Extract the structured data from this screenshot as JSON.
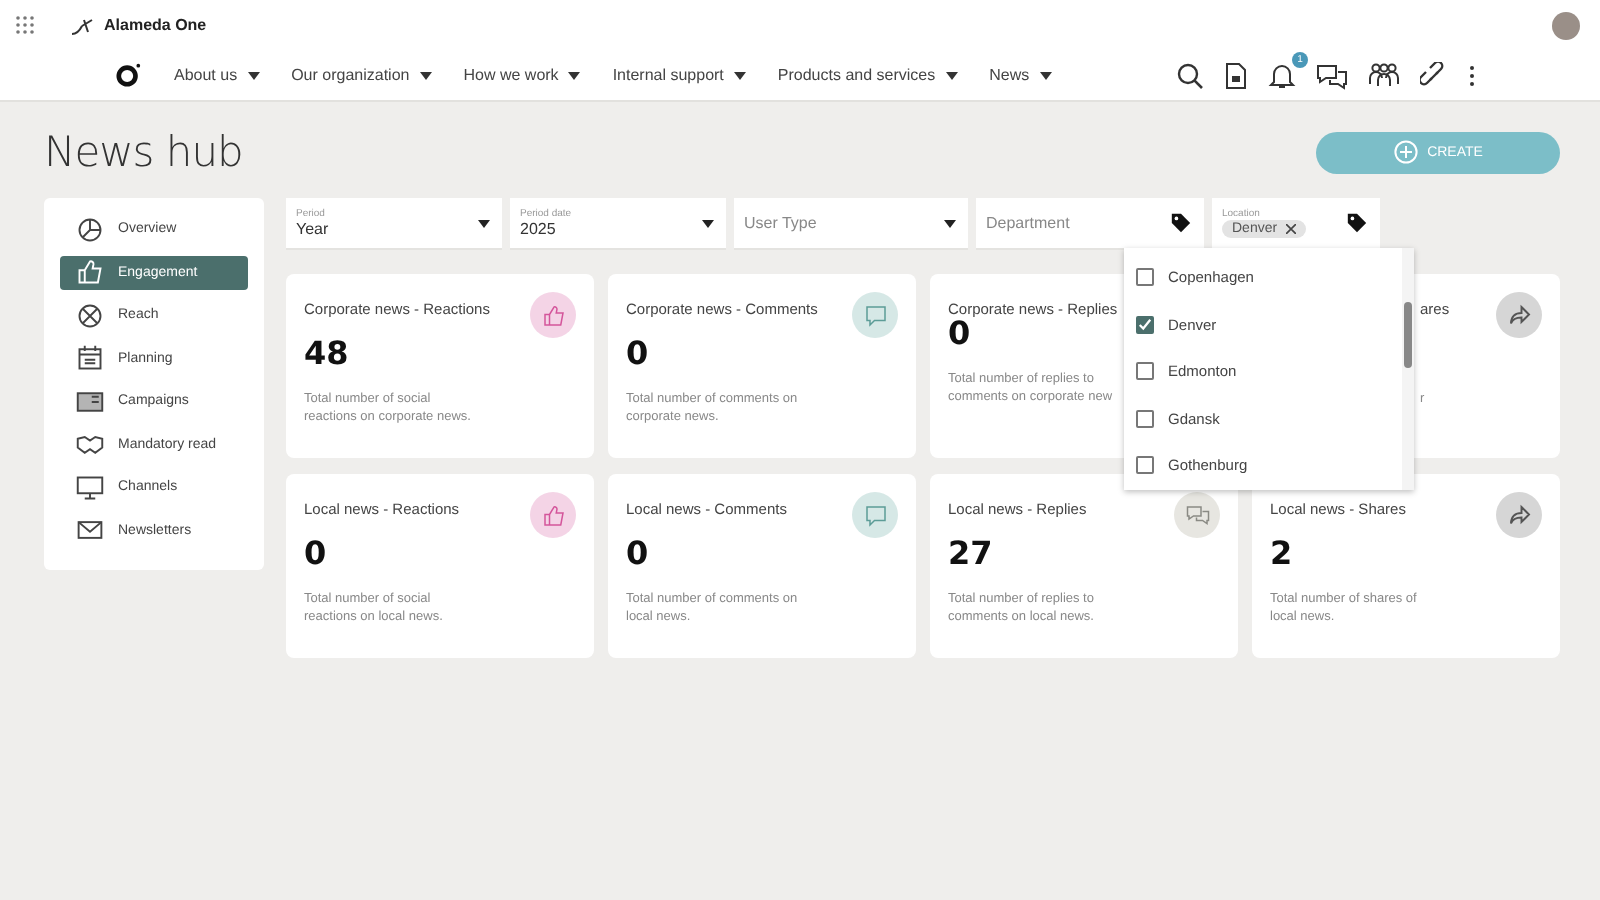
{
  "topbar": {
    "brand": "Alameda One"
  },
  "nav": {
    "items": [
      {
        "label": "About us"
      },
      {
        "label": "Our organization"
      },
      {
        "label": "How we work"
      },
      {
        "label": "Internal support"
      },
      {
        "label": "Products and services"
      },
      {
        "label": "News"
      }
    ],
    "notification_badge": "1"
  },
  "page": {
    "title": "News hub",
    "create_button": "CREATE"
  },
  "sidebar": {
    "items": [
      {
        "label": "Overview",
        "selected": false
      },
      {
        "label": "Engagement",
        "selected": true
      },
      {
        "label": "Reach",
        "selected": false
      },
      {
        "label": "Planning",
        "selected": false
      },
      {
        "label": "Campaigns",
        "selected": false
      },
      {
        "label": "Mandatory read",
        "selected": false
      },
      {
        "label": "Channels",
        "selected": false
      },
      {
        "label": "Newsletters",
        "selected": false
      }
    ]
  },
  "filters": [
    {
      "kind": "select",
      "label": "Period",
      "value": "Year"
    },
    {
      "kind": "select",
      "label": "Period date",
      "value": "2025"
    },
    {
      "kind": "select",
      "placeholder": "User Type"
    },
    {
      "kind": "tags",
      "placeholder": "Department"
    },
    {
      "kind": "tags",
      "label": "Location",
      "chips": [
        "Denver"
      ]
    }
  ],
  "location_dropdown": {
    "options": [
      {
        "label": "Copenhagen",
        "checked": false
      },
      {
        "label": "Denver",
        "checked": true
      },
      {
        "label": "Edmonton",
        "checked": false
      },
      {
        "label": "Gdansk",
        "checked": false
      },
      {
        "label": "Gothenburg",
        "checked": false
      }
    ]
  },
  "cards": [
    {
      "kind": "full",
      "title": "Corporate news - Reactions",
      "value": "48",
      "description": "Total number of social reactions on corporate news."
    },
    {
      "kind": "full",
      "title": "Corporate news - Comments",
      "value": "0",
      "description": "Total number of comments on corporate news."
    },
    {
      "kind": "icon-covered",
      "title": "Corporate news - Replies",
      "value": "0",
      "description": "Total number of replies to comments on corporate new"
    },
    {
      "kind": "covered",
      "title": "ares",
      "description": "r"
    },
    {
      "kind": "full",
      "title": "Local news - Reactions",
      "value": "0",
      "description": "Total number of social reactions on local news."
    },
    {
      "kind": "full",
      "title": "Local news - Comments",
      "value": "0",
      "description": "Total number of comments on local news."
    },
    {
      "kind": "full",
      "title": "Local news - Replies",
      "value": "27",
      "description": "Total number of replies to comments on local news."
    },
    {
      "kind": "full",
      "title": "Local news - Shares",
      "value": "2",
      "description": "Total number of shares of local news."
    }
  ]
}
